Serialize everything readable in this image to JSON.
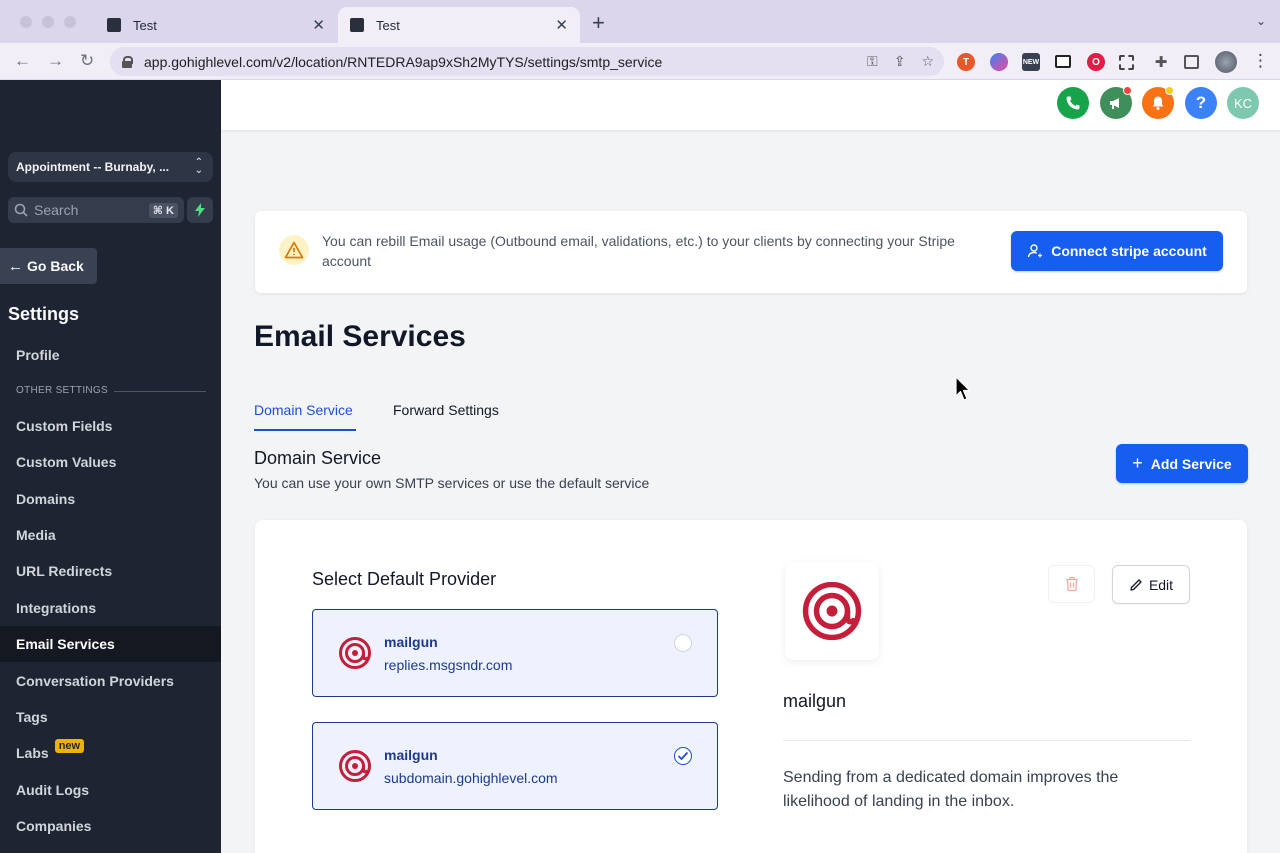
{
  "browser": {
    "tabs": [
      {
        "title": "Test",
        "active": false
      },
      {
        "title": "Test",
        "active": true
      }
    ],
    "new_tab_symbol": "+",
    "url": "app.gohighlevel.com/v2/location/RNTEDRA9ap9xSh2MyTYS/settings/smtp_service",
    "extension_icons": [
      "translate-ext-icon",
      "drop-ext-icon",
      "new-ext-icon",
      "pip-ext-icon",
      "opera-ext-icon",
      "screenshot-ext-icon",
      "puzzle-icon",
      "sidepanel-icon",
      "profile-avatar"
    ]
  },
  "sidebar": {
    "location": "Appointment -- Burnaby, ...",
    "search_placeholder": "Search",
    "search_shortcut": "⌘ K",
    "go_back": "Go Back",
    "title": "Settings",
    "profile": "Profile",
    "section_label": "OTHER SETTINGS",
    "items": [
      {
        "label": "Custom Fields",
        "active": false
      },
      {
        "label": "Custom Values",
        "active": false
      },
      {
        "label": "Domains",
        "active": false
      },
      {
        "label": "Media",
        "active": false
      },
      {
        "label": "URL Redirects",
        "active": false
      },
      {
        "label": "Integrations",
        "active": false
      },
      {
        "label": "Email Services",
        "active": true
      },
      {
        "label": "Conversation Providers",
        "active": false
      },
      {
        "label": "Tags",
        "active": false
      },
      {
        "label": "Labs",
        "active": false,
        "badge": "new"
      },
      {
        "label": "Audit Logs",
        "active": false
      },
      {
        "label": "Companies",
        "active": false
      }
    ]
  },
  "header": {
    "avatar_initials": "KC",
    "colors": {
      "phone": "#16a34a",
      "megaphone": "#3f8f5a",
      "bell": "#f97316",
      "help": "#3b82f6",
      "avatar": "#7ec8b0"
    }
  },
  "alert": {
    "text": "You can rebill Email usage (Outbound email, validations, etc.) to your clients by connecting your Stripe account",
    "button": "Connect stripe account"
  },
  "page": {
    "title": "Email Services",
    "tabs": [
      "Domain Service",
      "Forward Settings"
    ],
    "active_tab": "Domain Service",
    "section_title": "Domain Service",
    "section_subtitle": "You can use your own SMTP services or use the default service",
    "add_button": "Add Service"
  },
  "card": {
    "heading": "Select Default Provider",
    "providers": [
      {
        "name": "mailgun",
        "domain": "replies.msgsndr.com",
        "selected": false
      },
      {
        "name": "mailgun",
        "domain": "subdomain.gohighlevel.com",
        "selected": true
      }
    ],
    "detail_name": "mailgun",
    "edit_label": "Edit",
    "description": "Sending from a dedicated domain improves the likelihood of landing in the inbox."
  },
  "colors": {
    "primary": "#155eef",
    "sidebar_bg": "#1e2431",
    "mailgun_red": "#c41e3a"
  }
}
